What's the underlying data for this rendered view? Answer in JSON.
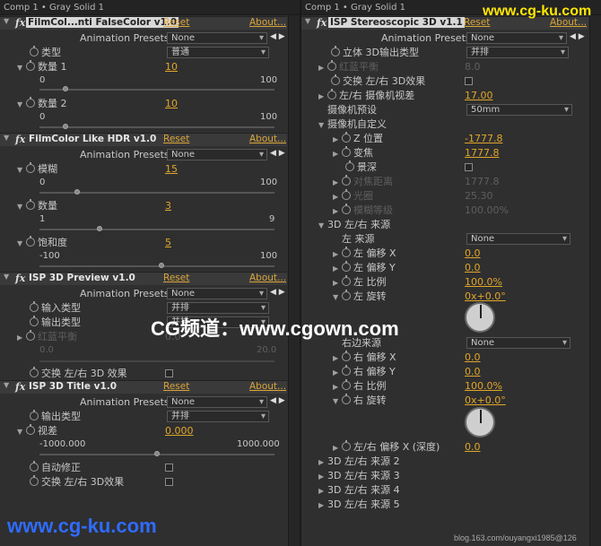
{
  "left": {
    "title": "Comp 1 • Gray Solid 1",
    "effects": [
      {
        "name": "FilmCol...nti FalseColor v1.0",
        "reset": "Reset",
        "about": "About..."
      },
      {
        "name": "FilmColor Like HDR v1.0",
        "reset": "Reset",
        "about": "About..."
      },
      {
        "name": "ISP 3D Preview v1.0",
        "reset": "Reset",
        "about": "About..."
      },
      {
        "name": "ISP 3D Title v1.0",
        "reset": "Reset",
        "about": "About..."
      }
    ],
    "anim_label": "Animation Presets:",
    "none": "None",
    "e1": {
      "type_label": "类型",
      "type_value": "普通",
      "n1_label": "数量 1",
      "n1_value": "10",
      "n1_min": "0",
      "n1_max": "100",
      "n2_label": "数量 2",
      "n2_value": "10",
      "n2_min": "0",
      "n2_max": "100"
    },
    "e2": {
      "blur_label": "模糊",
      "blur_value": "15",
      "blur_min": "0",
      "blur_max": "100",
      "qty_label": "数量",
      "qty_value": "3",
      "qty_min": "1",
      "qty_max": "9",
      "sat_label": "饱和度",
      "sat_value": "5",
      "sat_min": "-100",
      "sat_max": "100"
    },
    "e3": {
      "in_label": "输入类型",
      "in_value": "并排",
      "out_label": "输出类型",
      "out_value": "并排",
      "rb_label": "红蓝平衡",
      "rb_value": "0.0",
      "rb_min": "0.0",
      "rb_max": "20.0",
      "swap_label": "交换 左/右 3D 效果"
    },
    "e4": {
      "out_label": "输出类型",
      "out_value": "并排",
      "view_label": "视差",
      "view_value": "0.000",
      "view_min": "-1000.000",
      "view_max": "1000.000",
      "auto_label": "自动修正",
      "swap_label": "交换 左/右 3D效果"
    }
  },
  "right": {
    "title": "Comp 1 • Gray Solid 1",
    "effect": {
      "name": "ISP Stereoscopic 3D v1.1",
      "reset": "Reset",
      "about": "About..."
    },
    "anim_label": "Animation Presets:",
    "none": "None",
    "items": {
      "out3d_label": "立体 3D输出类型",
      "out3d_value": "并排",
      "rb_label": "红蓝平衡",
      "rb_value": "8.0",
      "swap_label": "交换 左/右 3D效果",
      "fov_label": "左/右 摄像机视差",
      "fov_value": "17.00",
      "cam_preset_label": "摄像机预设",
      "cam_preset_value": "50mm",
      "cam_custom_label": "摄像机自定义",
      "z_label": "Z 位置",
      "z_value": "-1777.8",
      "zoom_label": "变焦",
      "zoom_value": "1777.8",
      "dof_label": "景深",
      "focus_label": "对焦距离",
      "focus_value": "1777.8",
      "aperture_label": "光圈",
      "aperture_value": "25.30",
      "blur_label": "模糊等级",
      "blur_value": "100.00%",
      "src_label": "3D 左/右 来源",
      "left_src_label": "左 来源",
      "left_src_value": "None",
      "lx_label": "左 偏移 X",
      "lx_value": "0.0",
      "ly_label": "左 偏移 Y",
      "ly_value": "0.0",
      "ls_label": "左 比例",
      "ls_value": "100.0%",
      "lr_label": "左 旋转",
      "lr_value": "0x+0.0°",
      "right_src_label": "右边来源",
      "right_src_value": "None",
      "rx_label": "右 偏移 X",
      "rx_value": "0.0",
      "ry_label": "右 偏移 Y",
      "ry_value": "0.0",
      "rs_label": "右 比例",
      "rs_value": "100.0%",
      "rr_label": "右 旋转",
      "rr_value": "0x+0.0°",
      "depth_label": "左/右 偏移 X (深度)",
      "depth_value": "0.0",
      "src2": "3D 左/右 来源 2",
      "src3": "3D 左/右 来源 3",
      "src4": "3D 左/右 来源 4",
      "src5": "3D 左/右 来源 5"
    }
  },
  "watermarks": {
    "top": "www.cg-ku.com",
    "middle_a": "CG频道：",
    "middle_b": "www.cgown.com",
    "bottom": "www.cg-ku.com",
    "blog": "blog.163.com/ouyangxi1985@126"
  }
}
